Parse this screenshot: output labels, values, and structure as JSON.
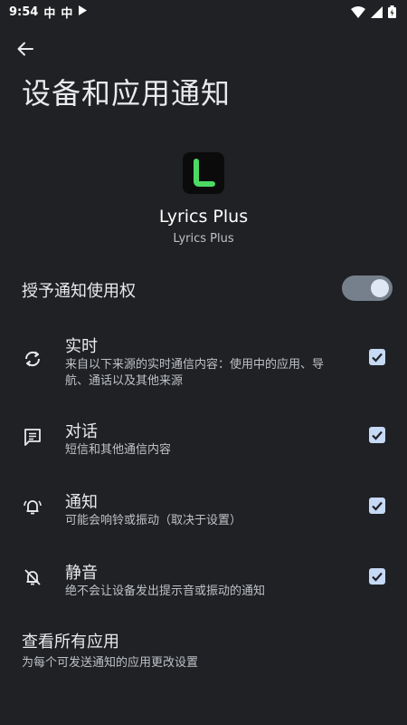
{
  "status_bar": {
    "time": "9:54",
    "notif_glyph": "中"
  },
  "header": {
    "title": "设备和应用通知"
  },
  "app": {
    "icon_letter": "L",
    "name": "Lyrics Plus",
    "package": "Lyrics Plus"
  },
  "grant": {
    "label": "授予通知使用权",
    "enabled": true
  },
  "options": [
    {
      "title": "实时",
      "subtitle": "来自以下来源的实时通信内容：使用中的应用、导航、通话以及其他来源",
      "checked": true,
      "icon": "sync-icon"
    },
    {
      "title": "对话",
      "subtitle": "短信和其他通信内容",
      "checked": true,
      "icon": "message-icon"
    },
    {
      "title": "通知",
      "subtitle": "可能会响铃或振动（取决于设置）",
      "checked": true,
      "icon": "alert-bell-icon"
    },
    {
      "title": "静音",
      "subtitle": "绝不会让设备发出提示音或振动的通知",
      "checked": true,
      "icon": "bell-off-icon"
    }
  ],
  "see_all": {
    "title": "查看所有应用",
    "subtitle": "为每个可发送通知的应用更改设置"
  },
  "colors": {
    "background": "#202124",
    "accent_checkbox": "#c6d9f5",
    "switch_track": "#76808d",
    "app_letter": "#4cd964"
  }
}
